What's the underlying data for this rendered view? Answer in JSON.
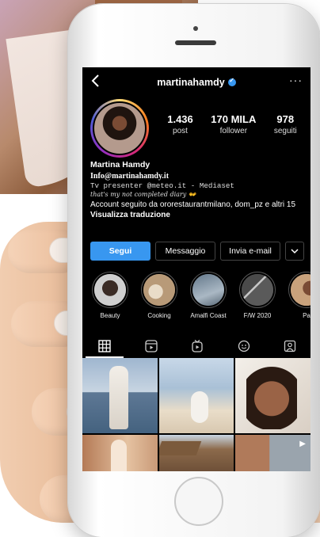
{
  "profile": {
    "username": "martinahamdy",
    "stats": [
      {
        "value": "1.436",
        "label": "post"
      },
      {
        "value": "170 MILA",
        "label": "follower"
      },
      {
        "value": "978",
        "label": "seguiti"
      }
    ],
    "bio": {
      "name": "Martina Hamdy",
      "email": "Info@martinahamdy.it",
      "job": "Tv presenter @meteo.it - Mediaset",
      "diary": "that's my not completed diary",
      "followed_by": "Account seguito da ororestaurantmilano, dom_pz e altri 15",
      "translate": "Visualizza traduzione"
    }
  },
  "buttons": {
    "follow": "Segui",
    "message": "Messaggio",
    "email": "Invia e-mail",
    "more_icon": "chevron-down-icon"
  },
  "highlights": [
    {
      "label": "Beauty",
      "color": "#d9d9d9"
    },
    {
      "label": "Cooking",
      "color": "#b89a78"
    },
    {
      "label": "Amalfi Coast",
      "color": "#7f93a6"
    },
    {
      "label": "F/W 2020",
      "color": "#6c6c6c"
    },
    {
      "label": "Pa",
      "color": "#c9a27c"
    }
  ],
  "tabs": [
    "grid-icon",
    "reels-icon",
    "igtv-icon",
    "tagged-icon",
    "guides-icon"
  ],
  "colors": {
    "accent": "#3897f0",
    "background": "#000000"
  }
}
